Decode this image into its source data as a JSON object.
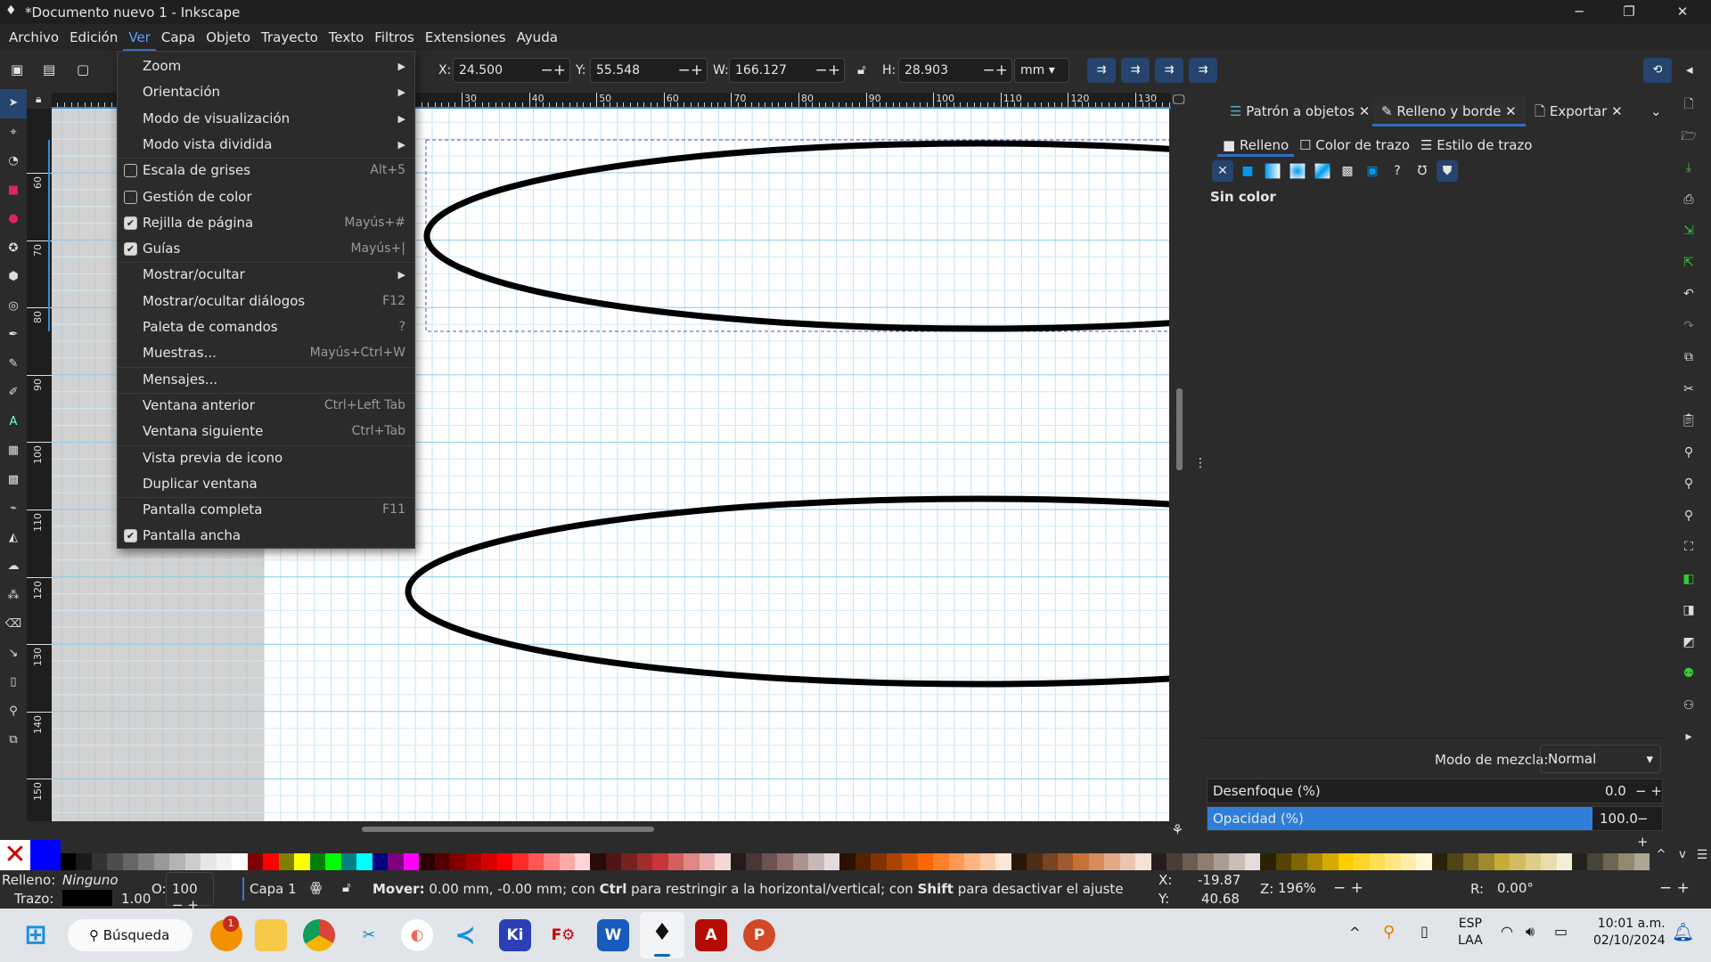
{
  "window": {
    "title": "*Documento nuevo 1 - Inkscape",
    "minimize": "─",
    "maximize": "❐",
    "close": "✕"
  },
  "menubar": [
    "Archivo",
    "Edición",
    "Ver",
    "Capa",
    "Objeto",
    "Trayecto",
    "Texto",
    "Filtros",
    "Extensiones",
    "Ayuda"
  ],
  "toolbar": {
    "x_label": "X:",
    "x": "24.500",
    "y_label": "Y:",
    "y": "55.548",
    "w_label": "W:",
    "w": "166.127",
    "h_label": "H:",
    "h": "28.903",
    "unit": "mm"
  },
  "view_menu": [
    {
      "label": "Zoom",
      "submenu": true
    },
    {
      "label": "Orientación",
      "submenu": true
    },
    {
      "label": "Modo de visualización",
      "submenu": true
    },
    {
      "label": "Modo vista dividida",
      "submenu": true
    },
    {
      "label": "Escala de grises",
      "shortcut": "Alt+5",
      "checkbox": true,
      "checked": false
    },
    {
      "label": "Gestión de color",
      "checkbox": true,
      "checked": false
    },
    {
      "label": "Rejilla de página",
      "shortcut": "Mayús+#",
      "checkbox": true,
      "checked": true
    },
    {
      "label": "Guías",
      "shortcut": "Mayús+|",
      "checkbox": true,
      "checked": true
    },
    {
      "label": "Mostrar/ocultar",
      "submenu": true
    },
    {
      "label": "Mostrar/ocultar diálogos",
      "shortcut": "F12"
    },
    {
      "label": "Paleta de comandos",
      "shortcut": "?"
    },
    {
      "label": "Muestras...",
      "shortcut": "Mayús+Ctrl+W"
    },
    {
      "label": "Mensajes..."
    },
    {
      "label": "Ventana anterior",
      "shortcut": "Ctrl+Left Tab"
    },
    {
      "label": "Ventana siguiente",
      "shortcut": "Ctrl+Tab"
    },
    {
      "label": "Vista previa de icono"
    },
    {
      "label": "Duplicar ventana"
    },
    {
      "label": "Pantalla completa",
      "shortcut": "F11"
    },
    {
      "label": "Pantalla ancha",
      "checkbox": true,
      "checked": true
    }
  ],
  "rulers": {
    "h": [
      "30",
      "40",
      "50",
      "60",
      "70",
      "80",
      "90",
      "100",
      "110",
      "120",
      "130"
    ],
    "v": [
      "60",
      "70",
      "80",
      "90",
      "100",
      "110",
      "120",
      "130",
      "140",
      "150"
    ]
  },
  "panel": {
    "tabs": [
      {
        "label": "Patrón a objetos"
      },
      {
        "label": "Relleno y borde",
        "active": true
      },
      {
        "label": "Exportar"
      }
    ],
    "subtabs": [
      {
        "label": "Relleno",
        "active": true
      },
      {
        "label": "Color de trazo"
      },
      {
        "label": "Estilo de trazo"
      }
    ],
    "fill_types": [
      "no-paint-icon",
      "flat-color-icon",
      "linear-gradient-icon",
      "radial-gradient-icon",
      "mesh-gradient-icon",
      "pattern-icon",
      "swatch-icon",
      "unset-icon",
      "fill-rule-evenodd-icon",
      "fill-rule-nonzero-icon"
    ],
    "fill_status": "Sin color",
    "blend_label": "Modo de mezcla:",
    "blend_value": "Normal",
    "blur_label": "Desenfoque (%)",
    "blur_value": "0.0",
    "opacity_label": "Opacidad (%)",
    "opacity_value": "100.0",
    "opacity_percent": 100,
    "accent": "#2f7fd8"
  },
  "palette": [
    "#000000",
    "#1a1a1a",
    "#333333",
    "#4d4d4d",
    "#666666",
    "#808080",
    "#999999",
    "#b3b3b3",
    "#cccccc",
    "#e6e6e6",
    "#f2f2f2",
    "#ffffff",
    "#800000",
    "#ff0000",
    "#808000",
    "#ffff00",
    "#008000",
    "#00ff00",
    "#008080",
    "#00ffff",
    "#000080",
    "#800080",
    "#ff00ff",
    "#2b0000",
    "#550000",
    "#800000",
    "#aa0000",
    "#d40000",
    "#ff0000",
    "#ff2a2a",
    "#ff5555",
    "#ff8080",
    "#ffaaaa",
    "#ffd5d5",
    "#280b0b",
    "#501616",
    "#782121",
    "#a02c2c",
    "#c83737",
    "#d35f5f",
    "#de8787",
    "#e9afaf",
    "#f4d7d7",
    "#241c1c",
    "#483737",
    "#6c5353",
    "#916f6f",
    "#ac9393",
    "#c8b7b7",
    "#e3dbdb",
    "#2b1100",
    "#552200",
    "#803300",
    "#aa4400",
    "#d45500",
    "#ff6600",
    "#ff7f2a",
    "#ff9955",
    "#ffb380",
    "#ffccaa",
    "#ffe6d5",
    "#28170b",
    "#502d16",
    "#784421",
    "#a05a2c",
    "#c87137",
    "#d38d5f",
    "#deaa87",
    "#e9c6af",
    "#f4e3d7",
    "#241f1c",
    "#483e37",
    "#6c5d53",
    "#917c6f",
    "#ac9d93",
    "#c8beb7",
    "#e3dedb",
    "#2b2200",
    "#554400",
    "#806600",
    "#aa8800",
    "#d4aa00",
    "#ffcc00",
    "#ffd42a",
    "#ffdd55",
    "#ffe680",
    "#ffeeaa",
    "#fff6d5",
    "#28220b",
    "#504416",
    "#786721",
    "#a0892c",
    "#c8ab37",
    "#d3bc5f",
    "#decd87",
    "#e9ddaf",
    "#f4eed7",
    "#24221c",
    "#484537",
    "#6c6753",
    "#918a6f",
    "#aca793"
  ],
  "status": {
    "fill_label": "Relleno:",
    "fill_value": "Ninguno",
    "stroke_label": "Trazo:",
    "stroke_width": "1.00",
    "opacity_label": "O:",
    "opacity": "100",
    "layer": "Capa 1",
    "message_bold1": "Mover:",
    "message1": " 0.00 mm, -0.00 mm; con ",
    "message_bold2": "Ctrl",
    "message2": " para restringir a la horizontal/vertical; con ",
    "message_bold3": "Shift",
    "message3": " para desactivar el ajuste",
    "cursor_x_label": "X:",
    "cursor_x": "-19.87",
    "cursor_y_label": "Y:",
    "cursor_y": "40.68",
    "zoom_label": "Z:",
    "zoom": "196%",
    "rotation_label": "R:",
    "rotation": "0.00°"
  },
  "taskbar": {
    "search": "Búsqueda",
    "badge": "1",
    "lang1": "ESP",
    "lang2": "LAA",
    "time": "10:01 a.m.",
    "date": "02/10/2024"
  }
}
